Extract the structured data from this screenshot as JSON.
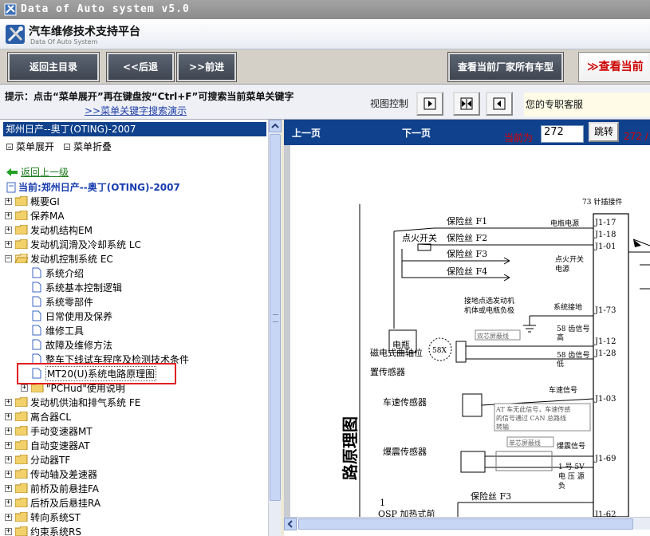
{
  "window": {
    "title": "Data of Auto system v5.0"
  },
  "header": {
    "title_cn": "汽车维修技术支持平台",
    "title_en": "Data Of Auto System"
  },
  "toolbar": {
    "home": "返回主目录",
    "back": "<<后退",
    "forward": ">>前进",
    "all_models": "查看当前厂家所有车型",
    "view_current": "查看当前"
  },
  "hint": {
    "text": "提示：点击“菜单展开”再在键盘按“Ctrl+F”可搜索当前菜单关键字",
    "demo_link": ">>菜单关键字搜索演示",
    "view_control": "视图控制",
    "service": "您的专职客服"
  },
  "sidebar": {
    "car_title": "郑州日产--奥丁(OTING)-2007",
    "expand": "菜单展开",
    "collapse": "菜单折叠",
    "back_up": "返回上一级",
    "current": "当前:郑州日产--奥丁(OTING)-2007",
    "tree": [
      {
        "label": "概要GI"
      },
      {
        "label": "保养MA"
      },
      {
        "label": "发动机结构EM"
      },
      {
        "label": "发动机润滑及冷却系统 LC"
      },
      {
        "label": "发动机控制系统 EC"
      },
      {
        "label": "系统介绍"
      },
      {
        "label": "系统基本控制逻辑"
      },
      {
        "label": "系统零部件"
      },
      {
        "label": "日常使用及保养"
      },
      {
        "label": "维修工具"
      },
      {
        "label": "故障及维修方法"
      },
      {
        "label": "整车下线试车程序及检测技术条件"
      },
      {
        "label": "MT20(U)系统电路原理图"
      },
      {
        "label": "\"PCHud\"使用说明"
      },
      {
        "label": "发动机供油和排气系统 FE"
      },
      {
        "label": "离合器CL"
      },
      {
        "label": "手动变速器MT"
      },
      {
        "label": "自动变速器AT"
      },
      {
        "label": "分动器TF"
      },
      {
        "label": "传动轴及差速器"
      },
      {
        "label": "前桥及前悬挂FA"
      },
      {
        "label": "后桥及后悬挂RA"
      },
      {
        "label": "转向系统ST"
      },
      {
        "label": "约束系统RS"
      }
    ]
  },
  "viewer": {
    "prev": "上一页",
    "next": "下一页",
    "current_label": "当前为",
    "page": "272",
    "jump": "跳转",
    "total": "272 /"
  },
  "diagram": {
    "connector": "73 针插接件",
    "fuse1": "保险丝 F1",
    "fuse2": "保险丝 F2",
    "fuse3": "保险丝 F3",
    "fuse4": "保险丝 F4",
    "fuse5": "保险丝 F3",
    "ignition": "点火开关",
    "battery": "电瓶",
    "power": "电瓶电源",
    "ign_power_1": "点火开关",
    "ign_power_2": "电源",
    "ground_1": "接地点选发动机",
    "ground_2": "机体或电瓶负极",
    "sys_ground": "系统接地",
    "shield1": "双芯屏蔽线",
    "shield2": "单芯屏蔽线",
    "tooth_high_1": "58 齿信号",
    "tooth_high_2": "高",
    "tooth_low_1": "58 齿信号",
    "tooth_low_2": "低",
    "crank_1": "磁电式曲轴位",
    "crank_2": "置传感器",
    "crank_badge": "58X",
    "speed_sensor": "车速传感器",
    "speed_signal": "车速信号",
    "at_note_1": "AT 车无此信号，车速传感",
    "at_note_2": "的信号通过 CAN 总路线",
    "at_note_3": "转输",
    "knock_sensor": "爆震传感器",
    "knock_signal": "爆震信号",
    "sv_1": "1 号 5V",
    "sv_2": "电 压 源",
    "sv_3": "负",
    "osp": "OSP 加热式前",
    "osp_num": "1",
    "pins": [
      "J1-17",
      "J1-18",
      "J1-01",
      "J1-73",
      "J1-12",
      "J1-28",
      "J1-03",
      "J1-69",
      "J1-62"
    ],
    "vertical_title": "路原理图"
  }
}
